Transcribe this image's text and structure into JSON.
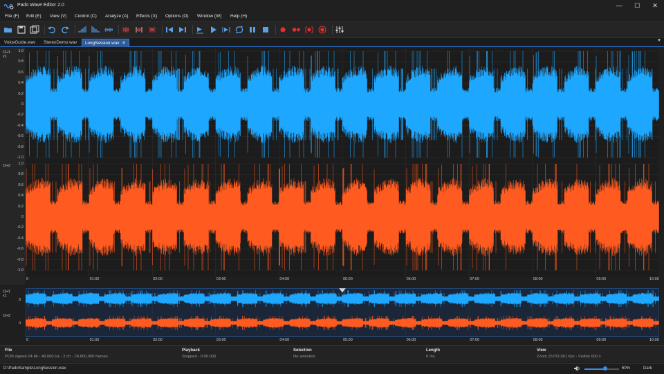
{
  "app": {
    "title": "Pado Wave Editor 2.0"
  },
  "window_controls": [
    "—",
    "☐",
    "✕"
  ],
  "menu": [
    "File (F)",
    "Edit (E)",
    "View (V)",
    "Control (C)",
    "Analyze (A)",
    "Effects (X)",
    "Options (O)",
    "Window (W)",
    "Help (H)"
  ],
  "toolbar": [
    {
      "icon": "open-folder-icon",
      "color": "#5aa0e8"
    },
    {
      "icon": "save-icon",
      "color": "#cfcfcf"
    },
    {
      "icon": "save-all-icon",
      "color": "#cfcfcf"
    },
    {
      "sep": true
    },
    {
      "icon": "undo-icon",
      "color": "#5aa0e8"
    },
    {
      "icon": "redo-icon",
      "color": "#5aa0e8"
    },
    {
      "sep": true
    },
    {
      "icon": "fade-in-icon",
      "color": "#5aa0e8"
    },
    {
      "icon": "fade-out-icon",
      "color": "#5aa0e8"
    },
    {
      "icon": "normalize-icon",
      "color": "#5aa0e8"
    },
    {
      "sep": true
    },
    {
      "icon": "cut-red-icon",
      "color": "#e04646"
    },
    {
      "icon": "trim-icon",
      "color": "#e04646"
    },
    {
      "icon": "delete-selection-icon",
      "color": "#e04646"
    },
    {
      "sep": true
    },
    {
      "icon": "skip-start-icon",
      "color": "#5aa0e8"
    },
    {
      "icon": "skip-end-icon",
      "color": "#5aa0e8"
    },
    {
      "sep": true
    },
    {
      "icon": "play-from-start-icon",
      "color": "#5aa0e8"
    },
    {
      "icon": "play-icon",
      "color": "#5aa0e8"
    },
    {
      "icon": "play-selection-icon",
      "color": "#5aa0e8"
    },
    {
      "icon": "loop-icon",
      "color": "#5aa0e8"
    },
    {
      "icon": "pause-icon",
      "color": "#5aa0e8"
    },
    {
      "icon": "stop-icon",
      "color": "#5aa0e8"
    },
    {
      "sep": true
    },
    {
      "icon": "record-icon",
      "color": "#e03030"
    },
    {
      "icon": "record-append-icon",
      "color": "#e03030"
    },
    {
      "icon": "record-selection-icon",
      "color": "#e03030"
    },
    {
      "icon": "record-target-icon",
      "color": "#e03030"
    },
    {
      "sep": true
    },
    {
      "icon": "mixer-icon",
      "color": "#cfcfcf"
    }
  ],
  "tabs": [
    {
      "label": "VoiceGuide.wav",
      "active": false
    },
    {
      "label": "StereoDemo.wav",
      "active": false
    },
    {
      "label": "LongSession.wav",
      "active": true,
      "close": "✕"
    }
  ],
  "tabs_dropdown": "▼",
  "main_view": {
    "ch1_label": "CH1",
    "ch1_zoom": "x1",
    "ch2_label": "CH2",
    "amp_ticks": [
      "1.0",
      "0.8",
      "0.6",
      "0.4",
      "0.2",
      "0",
      "-0.2",
      "-0.4",
      "-0.6",
      "-0.8",
      "-1.0"
    ],
    "time_ticks": [
      "0",
      "01:00",
      "02:00",
      "03:00",
      "04:00",
      "05:00",
      "06:00",
      "07:00",
      "08:00",
      "09:00",
      "10:00"
    ]
  },
  "overview": {
    "ch1_label": "CH1",
    "ch1_zoom": "x1",
    "ch2_label": "CH2",
    "zero": "0",
    "time_ticks": [
      "0",
      "01:00",
      "02:00",
      "03:00",
      "04:00",
      "05:00",
      "06:00",
      "07:00",
      "08:00",
      "09:00",
      "10:00"
    ],
    "playhead_fraction": 0.5
  },
  "status": [
    {
      "head": "File",
      "value": "PCM signed 24-bit - 48,000 Hz - 2 ch - 28,800,000 frames"
    },
    {
      "head": "Playback",
      "value": "Stopped - 0:00.000"
    },
    {
      "head": "Selection",
      "value": "No selection"
    },
    {
      "head": "Length",
      "value": "0 ms"
    },
    {
      "head": "View",
      "value": "Zoom 15703.381 f/px - Visible 600 s"
    }
  ],
  "bottom": {
    "path": "D:\\PadoSample\\LongSession.wav",
    "volume_pct": "60%",
    "volume": 0.6,
    "theme": "Dark"
  },
  "colors": {
    "ch1": "#1ea7ff",
    "ch2": "#ff5a1f",
    "grid": "#2e2e2e",
    "accent": "#3a8ee6"
  }
}
